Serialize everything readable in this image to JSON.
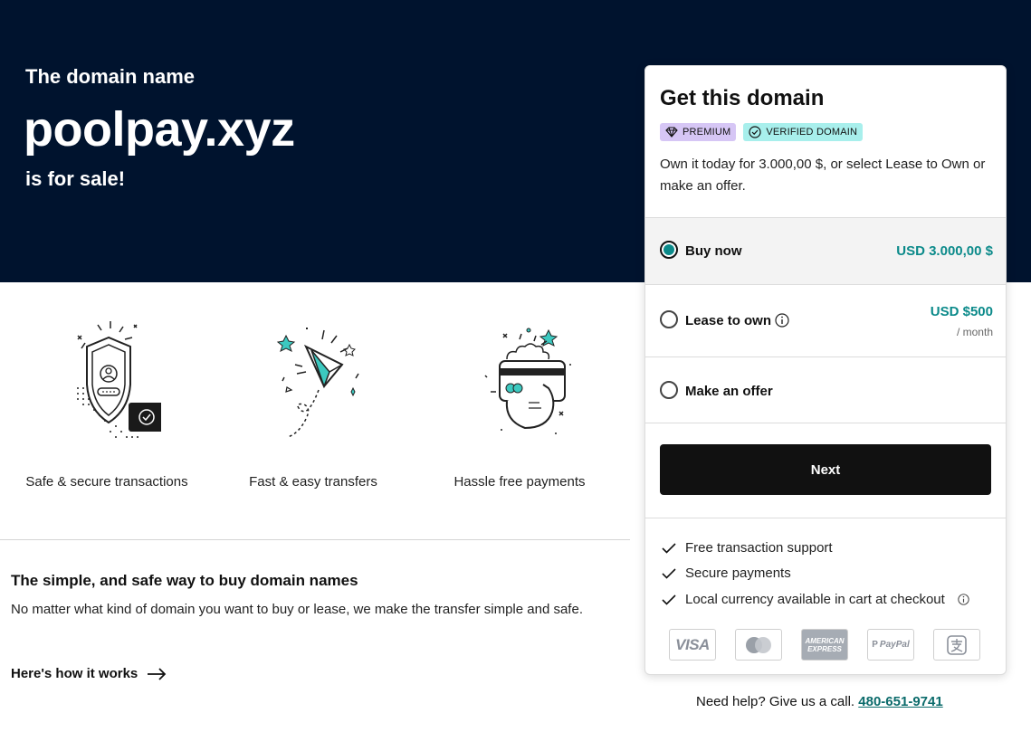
{
  "hero": {
    "line1": "The domain name",
    "domain": "poolpay.xyz",
    "line3": "is for sale!"
  },
  "features": [
    {
      "label": "Safe & secure transactions",
      "icon": "shield-check-icon"
    },
    {
      "label": "Fast & easy transfers",
      "icon": "paper-plane-icon"
    },
    {
      "label": "Hassle free payments",
      "icon": "hand-card-icon"
    }
  ],
  "info": {
    "heading": "The simple, and safe way to buy domain names",
    "text": "No matter what kind of domain you want to buy or lease, we make the transfer simple and safe.",
    "link": "Here's how it works"
  },
  "card": {
    "title": "Get this domain",
    "badges": {
      "premium": "PREMIUM",
      "verified": "VERIFIED DOMAIN"
    },
    "description": "Own it today for 3.000,00 $, or select Lease to Own or make an offer.",
    "options": {
      "buy": {
        "label": "Buy now",
        "price": "USD 3.000,00 $",
        "selected": true
      },
      "lease": {
        "label": "Lease to own",
        "price": "USD $500",
        "sub": "/ month",
        "selected": false
      },
      "offer": {
        "label": "Make an offer",
        "selected": false
      }
    },
    "next_label": "Next",
    "perks": [
      "Free transaction support",
      "Secure payments",
      "Local currency available in cart at checkout"
    ],
    "payments": {
      "visa": "VISA",
      "amex_line1": "AMERICAN",
      "amex_line2": "EXPRESS",
      "paypal": "PayPal"
    }
  },
  "help": {
    "text": "Need help? Give us a call.",
    "phone": "480-651-9741"
  },
  "colors": {
    "hero_bg": "#00132e",
    "accent": "#0b8a8a",
    "premium_badge": "#d6c6f5",
    "verified_badge": "#a8efec",
    "button_bg": "#111111"
  }
}
